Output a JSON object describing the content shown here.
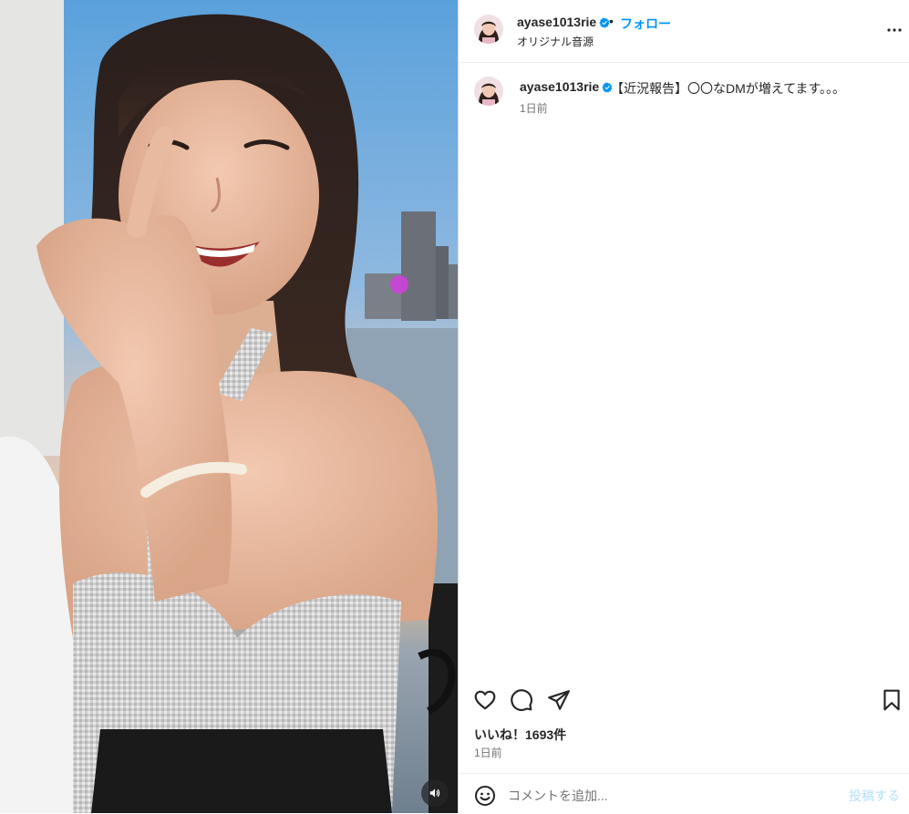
{
  "header": {
    "username": "ayase1013rie",
    "separator": "•",
    "follow_label": "フォロー",
    "audio_label": "オリジナル音源"
  },
  "caption": {
    "username": "ayase1013rie",
    "text": "【近況報告】〇〇なDMが増えてます。。。",
    "time": "1日前"
  },
  "actions": {
    "like_icon": "heart-icon",
    "comment_icon": "comment-icon",
    "share_icon": "share-icon",
    "save_icon": "bookmark-icon"
  },
  "likes_label": "いいね！1693件",
  "date_label": "1日前",
  "comment_box": {
    "placeholder": "コメントを追加...",
    "post_label": "投稿する",
    "emoji_icon": "emoji-icon"
  },
  "media": {
    "mute_icon": "speaker-icon"
  },
  "colors": {
    "accent": "#0095f6",
    "verified": "#0095f6",
    "post_disabled": "#b2dffc",
    "secondary_text": "#737373"
  }
}
